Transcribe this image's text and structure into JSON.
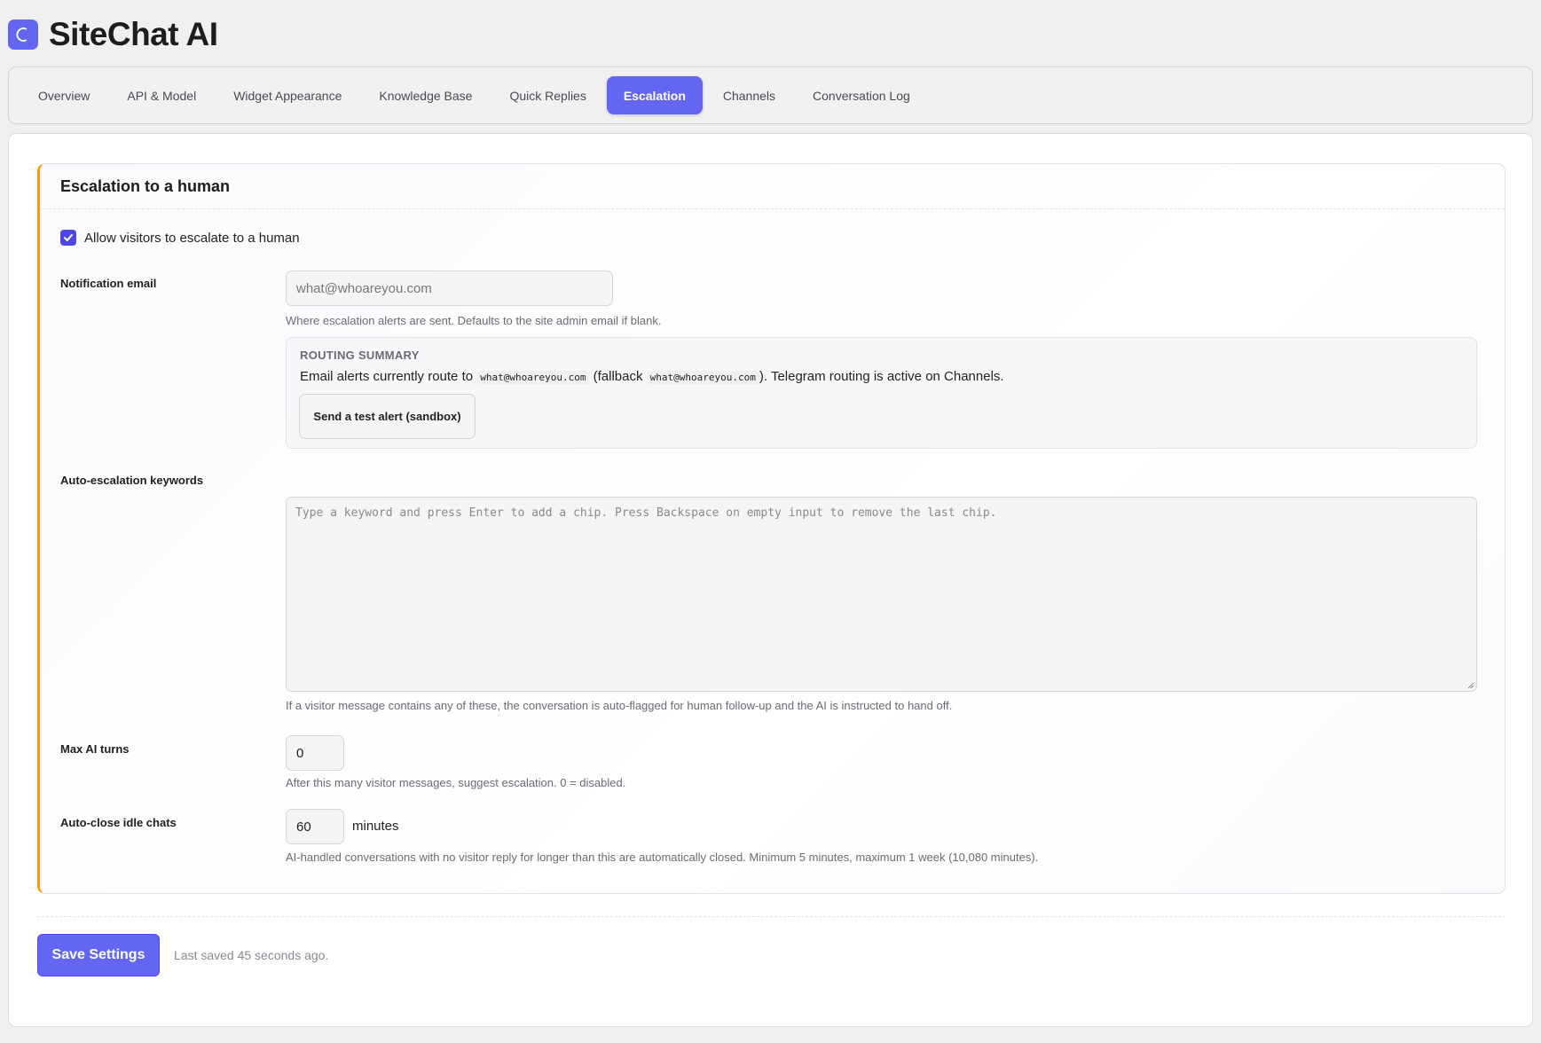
{
  "app": {
    "title": "SiteChat AI",
    "logo_icon": "crescent-icon",
    "accent_color": "#6366f1"
  },
  "tabs": [
    {
      "label": "Overview",
      "active": false
    },
    {
      "label": "API & Model",
      "active": false
    },
    {
      "label": "Widget Appearance",
      "active": false
    },
    {
      "label": "Knowledge Base",
      "active": false
    },
    {
      "label": "Quick Replies",
      "active": false
    },
    {
      "label": "Escalation",
      "active": true
    },
    {
      "label": "Channels",
      "active": false
    },
    {
      "label": "Conversation Log",
      "active": false
    }
  ],
  "escalation": {
    "title": "Escalation to a human",
    "allow_checkbox": {
      "label": "Allow visitors to escalate to a human",
      "checked": true
    },
    "notification_email": {
      "label": "Notification email",
      "placeholder": "what@whoareyou.com",
      "value": "",
      "help": "Where escalation alerts are sent. Defaults to the site admin email if blank."
    },
    "routing_summary": {
      "title": "ROUTING SUMMARY",
      "text_prefix": "Email alerts currently route to",
      "route_email": "what@whoareyou.com",
      "text_middle": "(fallback",
      "fallback_email": "what@whoareyou.com",
      "text_suffix": "). Telegram routing is active on Channels.",
      "test_button": "Send a test alert (sandbox)"
    },
    "keywords": {
      "label": "Auto-escalation keywords",
      "placeholder": "Type a keyword and press Enter to add a chip. Press Backspace on empty input to remove the last chip.",
      "help": "If a visitor message contains any of these, the conversation is auto-flagged for human follow-up and the AI is instructed to hand off."
    },
    "max_turns": {
      "label": "Max AI turns",
      "value": "0",
      "help": "After this many visitor messages, suggest escalation. 0 = disabled."
    },
    "auto_close": {
      "label": "Auto-close idle chats",
      "value": "60",
      "unit": "minutes",
      "help": "AI-handled conversations with no visitor reply for longer than this are automatically closed. Minimum 5 minutes, maximum 1 week (10,080 minutes)."
    }
  },
  "footer": {
    "save_button": "Save Settings",
    "saved_status": "Last saved 45 seconds ago."
  }
}
